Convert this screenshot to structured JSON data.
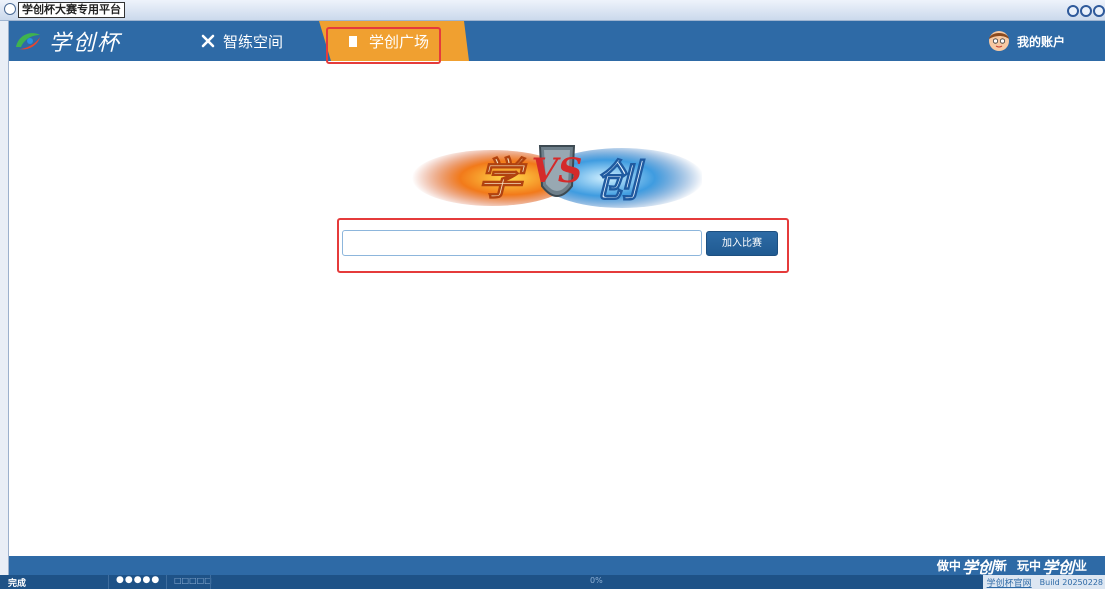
{
  "window": {
    "title": "学创杯大赛专用平台"
  },
  "nav": {
    "logo_text": "学创杯",
    "items": [
      {
        "label": "智练空间",
        "icon": "tools-icon"
      },
      {
        "label": "学创广场",
        "icon": "document-icon",
        "active": true
      }
    ],
    "account_label": "我的账户"
  },
  "main": {
    "join_input": {
      "value": "",
      "placeholder": ""
    },
    "join_button_label": "加入比赛"
  },
  "footer": {
    "slogan": [
      {
        "prefix": "做中",
        "mark": "学创",
        "suffix": "新"
      },
      {
        "prefix": "玩中",
        "mark": "学创",
        "suffix": "业"
      }
    ]
  },
  "statusbar": {
    "status": "完成",
    "dots_filled": "●●●●●",
    "dots_empty": "□□□□□",
    "progress": "0%",
    "official_link": "学创杯官网",
    "build": "Build 20250228"
  },
  "colors": {
    "nav_bg": "#2e6aa6",
    "active_tab": "#f0a030",
    "highlight": "#e53b3b",
    "button_bg": "#2563a0"
  }
}
